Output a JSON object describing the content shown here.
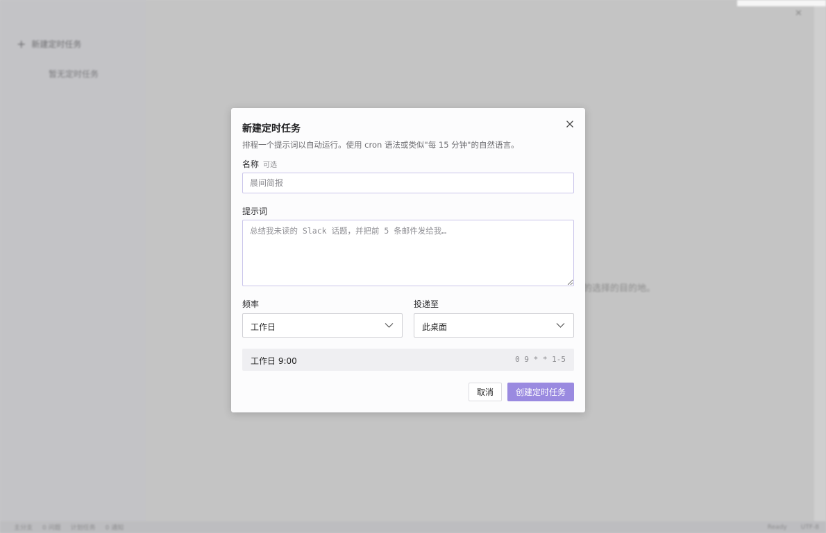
{
  "background": {
    "sidebar_new_task": "新建定时任务",
    "sidebar_empty": "暂无定时任务",
    "main_hint": "的选择的目的地。",
    "status_left": [
      "主分支",
      "0 问题",
      "计划任务",
      "0 通知"
    ],
    "status_right": [
      "Ready",
      "UTF-8"
    ]
  },
  "modal": {
    "title": "新建定时任务",
    "description": "排程一个提示词以自动运行。使用 cron 语法或类似\"每 15 分钟\"的自然语言。",
    "name_label": "名称",
    "name_optional": "可选",
    "name_placeholder": "晨间简报",
    "prompt_label": "提示词",
    "prompt_placeholder": "总结我未读的 Slack 话题，并把前 5 条邮件发给我…",
    "frequency_label": "频率",
    "frequency_value": "工作日",
    "deliver_label": "投递至",
    "deliver_value": "此桌面",
    "schedule_text": "工作日 9:00",
    "cron_expr": "0 9 * * 1-5",
    "cancel_label": "取消",
    "create_label": "创建定时任务"
  },
  "colors": {
    "accent": "#9a8ae0",
    "input_border": "#c9c4ea"
  },
  "icons": {
    "close": "close-icon",
    "plus": "plus-icon",
    "chevron": "chevron-down-icon"
  }
}
